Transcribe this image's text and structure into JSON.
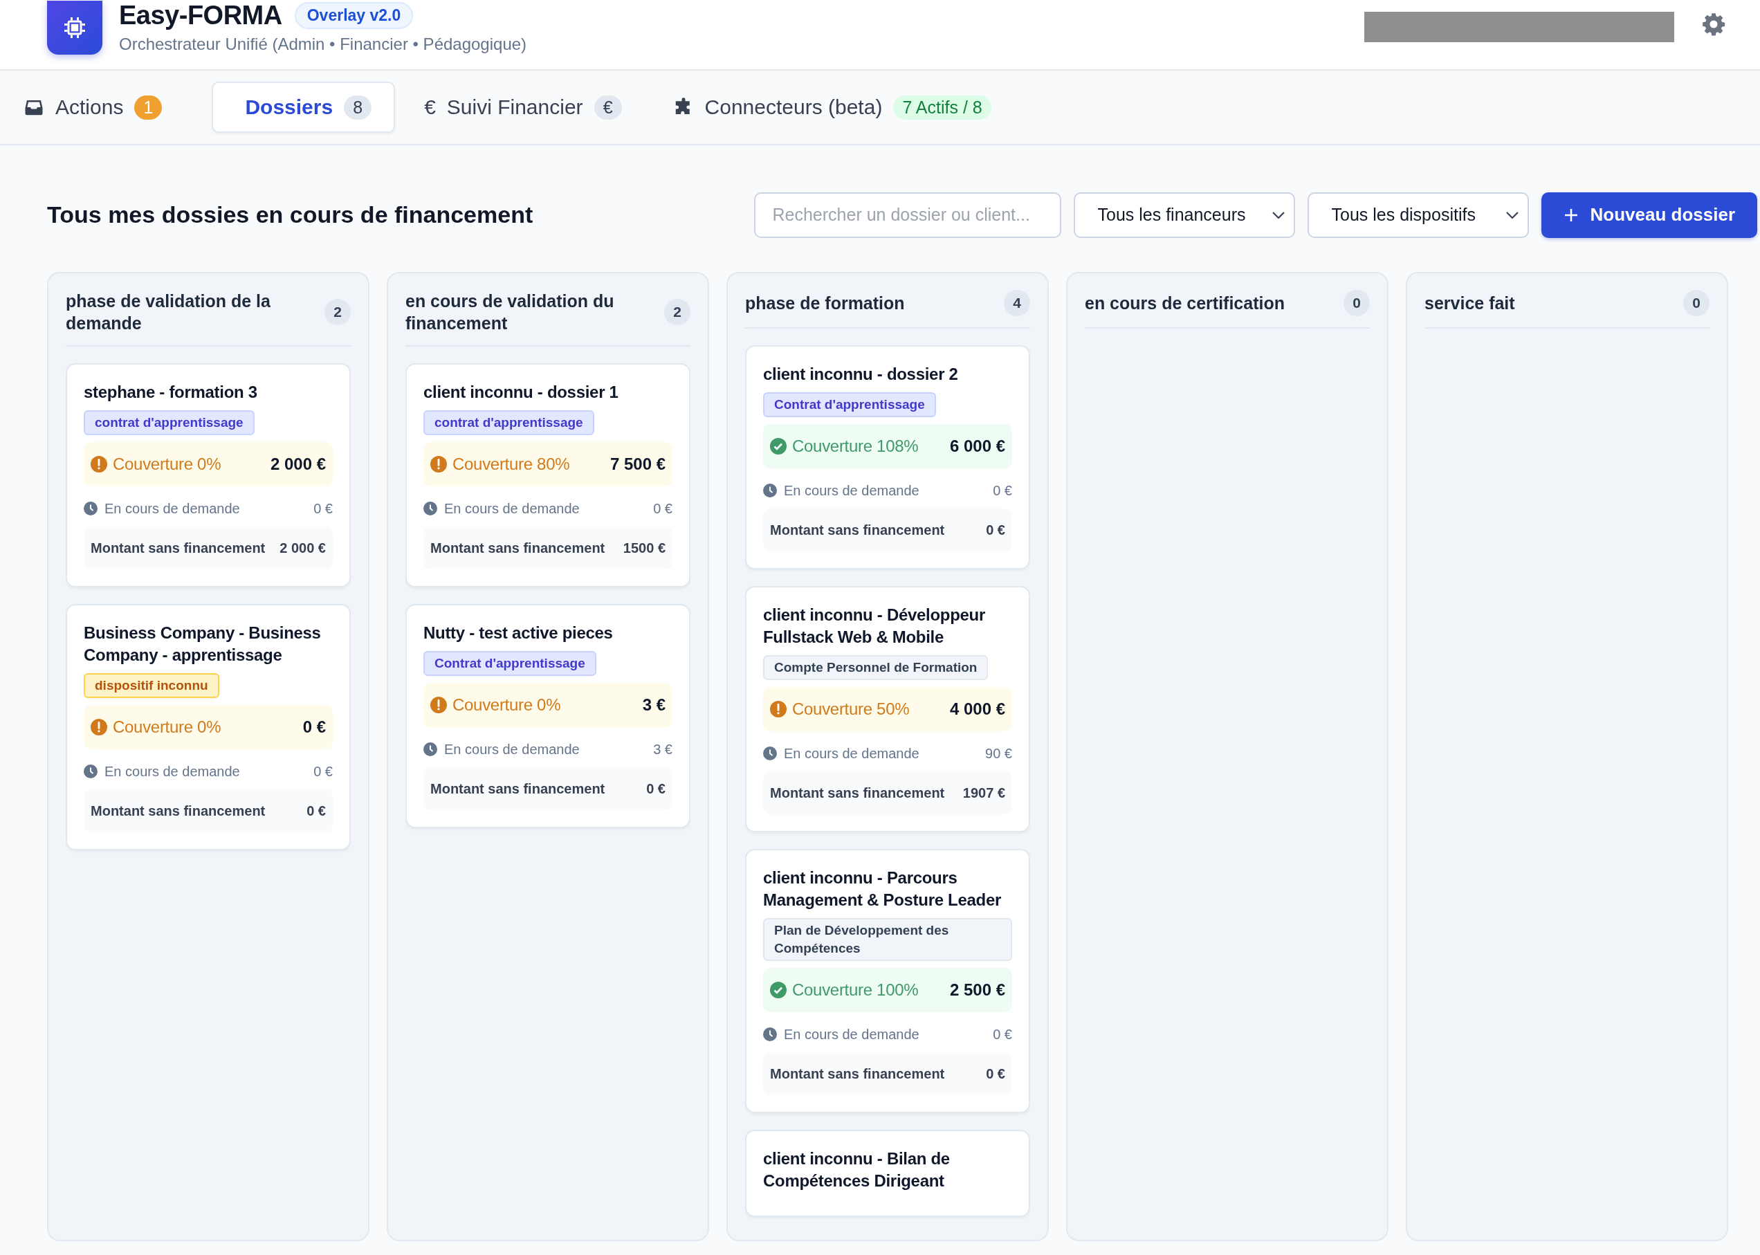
{
  "app": {
    "name": "Easy-FORMA",
    "version": "Overlay v2.0",
    "subtitle": "Orchestrateur Unifié (Admin • Financier • Pédagogique)"
  },
  "tabs": [
    {
      "kind": "inbox",
      "label": "Actions",
      "badge": "1",
      "color": "#f0a030",
      "selected": false
    },
    {
      "kind": "plain",
      "label": "Dossiers",
      "badge": "8",
      "color": "#e2e8f0",
      "selected": true
    },
    {
      "kind": "euro",
      "icon": "€",
      "label": "Suivi Financier",
      "badge": "€",
      "color": "#e2e8f0",
      "selected": false
    },
    {
      "kind": "puzzle",
      "label": "Connecteurs (beta)",
      "badge": "7 Actifs / 8",
      "color": "#dcfce7",
      "selected": false
    }
  ],
  "toolbar": {
    "title": "Tous mes dossies en cours de financement",
    "search": {
      "placeholder": "Rechercher un dossier ou client..."
    },
    "filters": [
      "Tous les financeurs",
      "Tous les dispositifs"
    ],
    "new_button": "Nouveau dossier"
  },
  "columns": [
    {
      "title": "phase de validation de la demande",
      "count": "2",
      "cards": [
        {
          "title": "stephane - formation 3",
          "tag": {
            "text": "contrat d'apprentissage",
            "kind": "blue"
          },
          "coverage": {
            "kind": "warning",
            "text": "Couverture 0%",
            "amount": "2 000 €"
          },
          "pending": {
            "label": "En cours de demande",
            "amount": "0 €"
          },
          "unfunded": {
            "label": "Montant sans financement",
            "amount": "2 000 €"
          }
        },
        {
          "title": "Business Company - Business Company - apprentissage",
          "tag": {
            "text": "dispositif inconnu",
            "kind": "yellow"
          },
          "coverage": {
            "kind": "warning",
            "text": "Couverture 0%",
            "amount": "0 €"
          },
          "pending": {
            "label": "En cours de demande",
            "amount": "0 €"
          },
          "unfunded": {
            "label": "Montant sans financement",
            "amount": "0 €"
          }
        }
      ]
    },
    {
      "title": "en cours de validation du financement",
      "count": "2",
      "cards": [
        {
          "title": "client inconnu - dossier 1",
          "tag": {
            "text": "contrat d'apprentissage",
            "kind": "blue"
          },
          "coverage": {
            "kind": "warning",
            "text": "Couverture 80%",
            "amount": "7 500 €"
          },
          "pending": {
            "label": "En cours de demande",
            "amount": "0 €"
          },
          "unfunded": {
            "label": "Montant sans financement",
            "amount": "1500 €"
          }
        },
        {
          "title": "Nutty - test active pieces",
          "tag": {
            "text": "Contrat d'apprentissage",
            "kind": "blue"
          },
          "coverage": {
            "kind": "warning",
            "text": "Couverture 0%",
            "amount": "3 €"
          },
          "pending": {
            "label": "En cours de demande",
            "amount": "3 €"
          },
          "unfunded": {
            "label": "Montant sans financement",
            "amount": "0 €"
          }
        }
      ]
    },
    {
      "title": "phase de formation",
      "count": "4",
      "cards": [
        {
          "title": "client inconnu - dossier 2",
          "tag": {
            "text": "Contrat d'apprentissage",
            "kind": "blue"
          },
          "coverage": {
            "kind": "ok",
            "text": "Couverture 108%",
            "amount": "6 000 €"
          },
          "pending": {
            "label": "En cours de demande",
            "amount": "0 €"
          },
          "unfunded": {
            "label": "Montant sans financement",
            "amount": "0 €"
          }
        },
        {
          "title": "client inconnu - Développeur Fullstack Web & Mobile",
          "tag": {
            "text": "Compte Personnel de Formation",
            "kind": "gray"
          },
          "coverage": {
            "kind": "warning",
            "text": "Couverture 50%",
            "amount": "4 000 €"
          },
          "pending": {
            "label": "En cours de demande",
            "amount": "90 €"
          },
          "unfunded": {
            "label": "Montant sans financement",
            "amount": "1907 €"
          }
        },
        {
          "title": "client inconnu - Parcours Management & Posture Leader",
          "tag": {
            "text": "Plan de Développement des Compétences",
            "kind": "gray"
          },
          "coverage": {
            "kind": "ok",
            "text": "Couverture 100%",
            "amount": "2 500 €"
          },
          "pending": {
            "label": "En cours de demande",
            "amount": "0 €"
          },
          "unfunded": {
            "label": "Montant sans financement",
            "amount": "0 €"
          }
        },
        {
          "title": "client inconnu - Bilan de Compétences Dirigeant"
        }
      ]
    },
    {
      "title": "en cours de certification",
      "count": "0"
    },
    {
      "title": "service fait",
      "count": "0"
    }
  ]
}
